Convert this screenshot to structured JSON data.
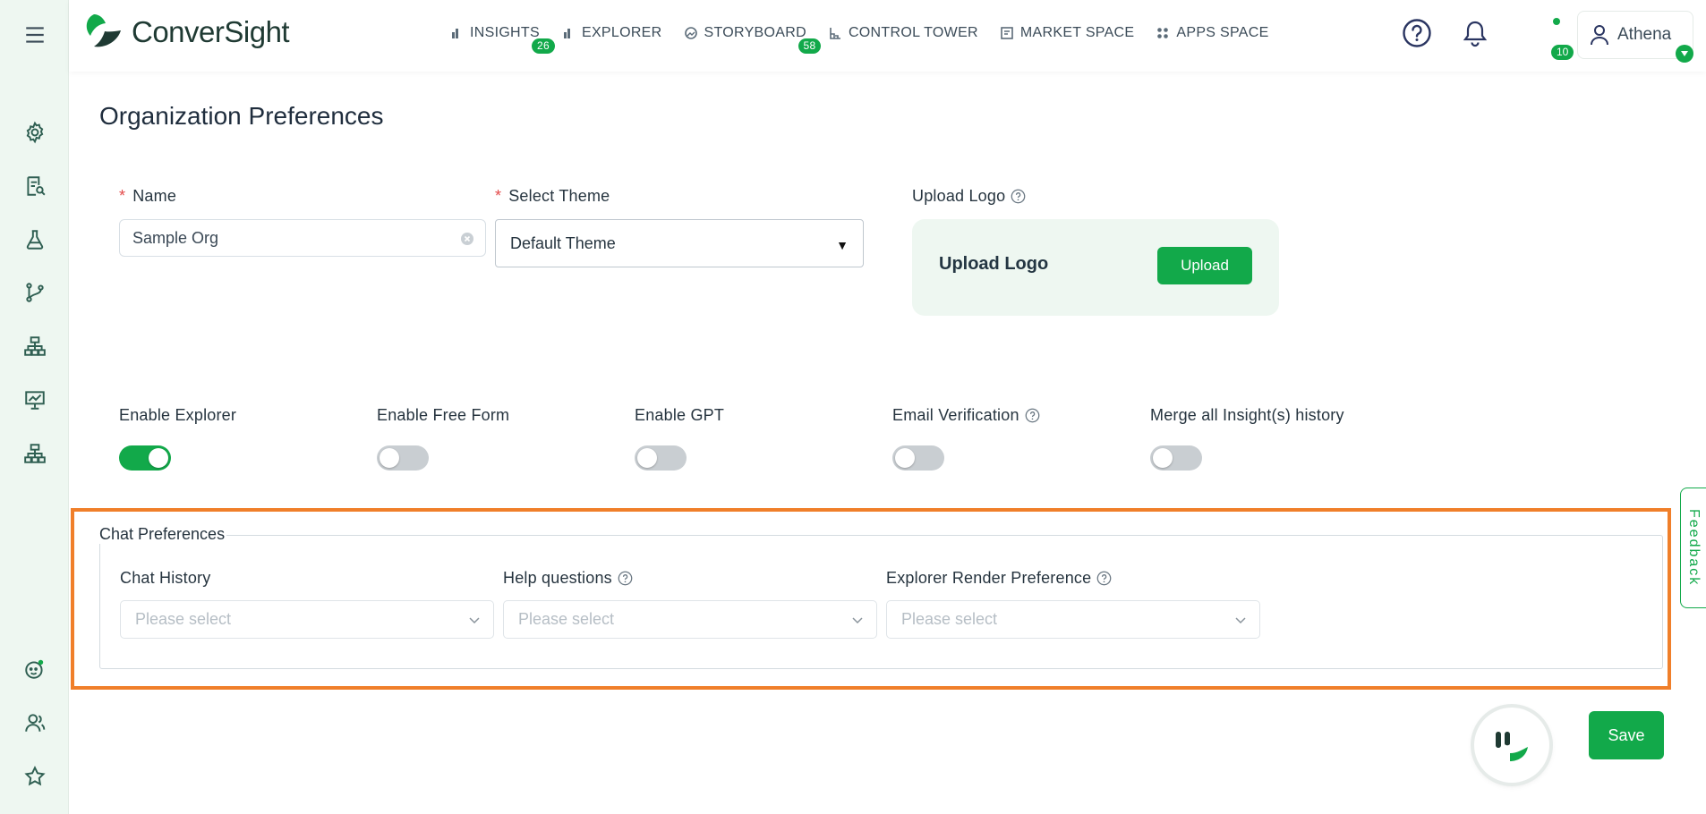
{
  "app": {
    "logo_text": "ConverSight"
  },
  "nav": [
    {
      "label": "INSIGHTS",
      "badge": "26",
      "icon": "bar-chart-icon"
    },
    {
      "label": "EXPLORER",
      "badge": "",
      "icon": "bar-chart-icon"
    },
    {
      "label": "STORYBOARD",
      "badge": "58",
      "icon": "storyboard-icon"
    },
    {
      "label": "CONTROL TOWER",
      "badge": "",
      "icon": "control-tower-icon"
    },
    {
      "label": "MARKET SPACE",
      "badge": "",
      "icon": "market-icon"
    },
    {
      "label": "APPS SPACE",
      "badge": "",
      "icon": "apps-grid-icon"
    }
  ],
  "header": {
    "notifications_count": "10",
    "user_name": "Athena"
  },
  "page": {
    "title": "Organization Preferences"
  },
  "form": {
    "name_label": "Name",
    "name_value": "Sample Org",
    "theme_label": "Select Theme",
    "theme_value": "Default Theme",
    "upload_label": "Upload Logo",
    "upload_box_text": "Upload Logo",
    "upload_button": "Upload"
  },
  "toggles": [
    {
      "label": "Enable Explorer",
      "on": true,
      "help": false
    },
    {
      "label": "Enable Free Form",
      "on": false,
      "help": false
    },
    {
      "label": "Enable GPT",
      "on": false,
      "help": false
    },
    {
      "label": "Email Verification",
      "on": false,
      "help": true
    },
    {
      "label": "Merge all Insight(s) history",
      "on": false,
      "help": false
    }
  ],
  "chat_preferences": {
    "legend": "Chat Preferences",
    "fields": [
      {
        "label": "Chat History",
        "placeholder": "Please select",
        "help": false
      },
      {
        "label": "Help questions",
        "placeholder": "Please select",
        "help": true
      },
      {
        "label": "Explorer Render Preference",
        "placeholder": "Please select",
        "help": true
      }
    ]
  },
  "feedback_label": "Feedback",
  "save_label": "Save",
  "colors": {
    "accent": "#12a94a",
    "highlight": "#f07f2a",
    "rail_bg": "#eef7f1"
  }
}
